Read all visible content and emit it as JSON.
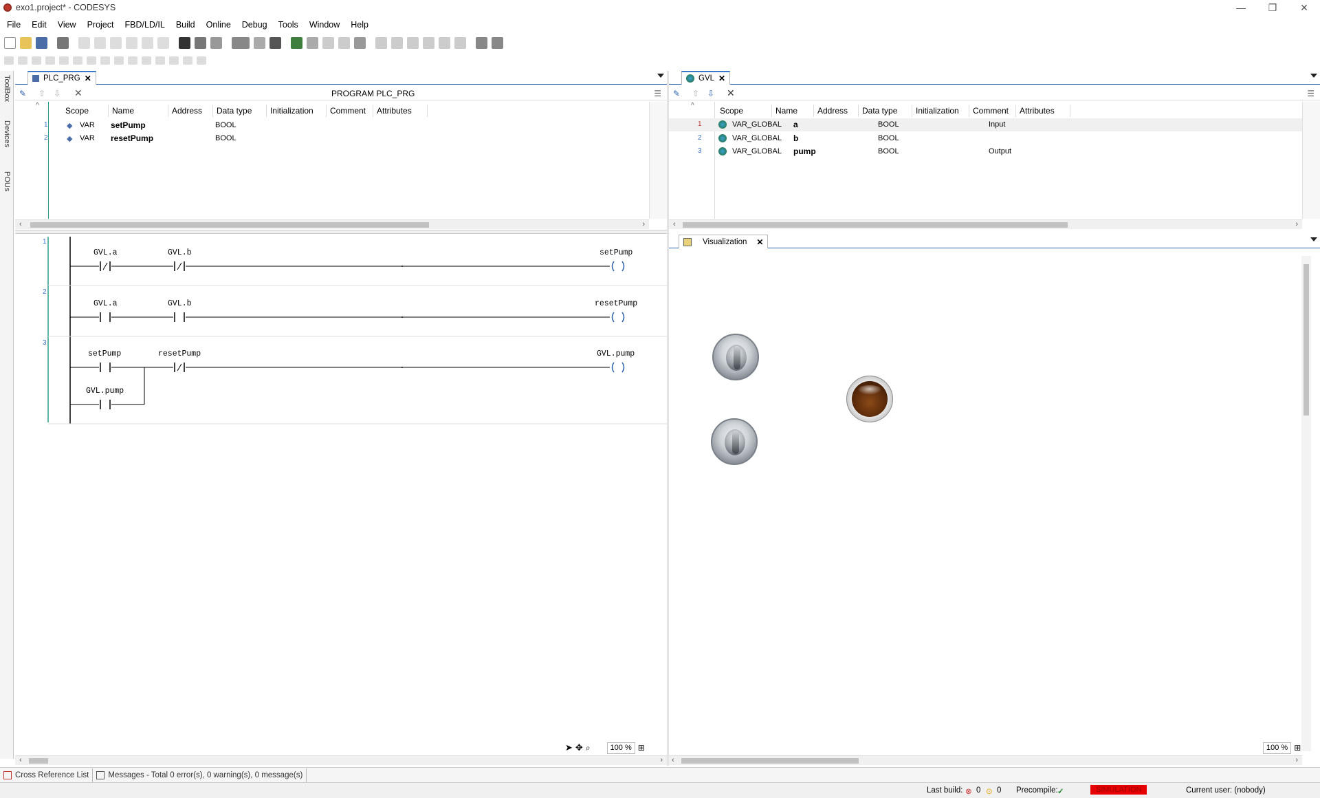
{
  "window": {
    "title": "exo1.project* - CODESYS"
  },
  "menu": [
    "File",
    "Edit",
    "View",
    "Project",
    "FBD/LD/IL",
    "Build",
    "Online",
    "Debug",
    "Tools",
    "Window",
    "Help"
  ],
  "side_tabs": [
    "ToolBox",
    "Devices",
    "POUs"
  ],
  "left_editor": {
    "tab_label": "PLC_PRG",
    "program_title": "PROGRAM PLC_PRG",
    "columns": [
      "Scope",
      "Name",
      "Address",
      "Data type",
      "Initialization",
      "Comment",
      "Attributes"
    ],
    "rows": [
      {
        "n": "1",
        "scope": "VAR",
        "name": "setPump",
        "address": "",
        "type": "BOOL",
        "init": "",
        "comment": "",
        "attributes": ""
      },
      {
        "n": "2",
        "scope": "VAR",
        "name": "resetPump",
        "address": "",
        "type": "BOOL",
        "init": "",
        "comment": "",
        "attributes": ""
      }
    ],
    "rungs": [
      {
        "n": "1",
        "c1": "GVL.a",
        "c2": "GVL.b",
        "coil": "setPump"
      },
      {
        "n": "2",
        "c1": "GVL.a",
        "c2": "GVL.b",
        "coil": "resetPump"
      },
      {
        "n": "3",
        "c1": "setPump",
        "c2": "resetPump",
        "coil": "GVL.pump",
        "branch": "GVL.pump"
      }
    ],
    "zoom": "100 %"
  },
  "right_editor": {
    "tab_label": "GVL",
    "columns": [
      "Scope",
      "Name",
      "Address",
      "Data type",
      "Initialization",
      "Comment",
      "Attributes"
    ],
    "rows": [
      {
        "n": "1",
        "scope": "VAR_GLOBAL",
        "name": "a",
        "address": "",
        "type": "BOOL",
        "init": "",
        "comment": "Input",
        "attributes": ""
      },
      {
        "n": "2",
        "scope": "VAR_GLOBAL",
        "name": "b",
        "address": "",
        "type": "BOOL",
        "init": "",
        "comment": "",
        "attributes": ""
      },
      {
        "n": "3",
        "scope": "VAR_GLOBAL",
        "name": "pump",
        "address": "",
        "type": "BOOL",
        "init": "",
        "comment": "Output",
        "attributes": ""
      }
    ]
  },
  "visualization": {
    "tab_label": "Visualization",
    "zoom": "100 %"
  },
  "bottom_tabs": {
    "xref": "Cross Reference List",
    "messages": "Messages - Total 0 error(s), 0 warning(s), 0 message(s)"
  },
  "status": {
    "last_build_label": "Last build:",
    "errors": "0",
    "warnings": "0",
    "precompile_label": "Precompile:",
    "mode": "SIMULATION",
    "user": "Current user: (nobody)"
  },
  "colors": {
    "accent": "#3b77c6",
    "line_number": "#3a6fc4",
    "simulation_bg": "#e60000",
    "rung_bar": "#2a9a8a"
  }
}
